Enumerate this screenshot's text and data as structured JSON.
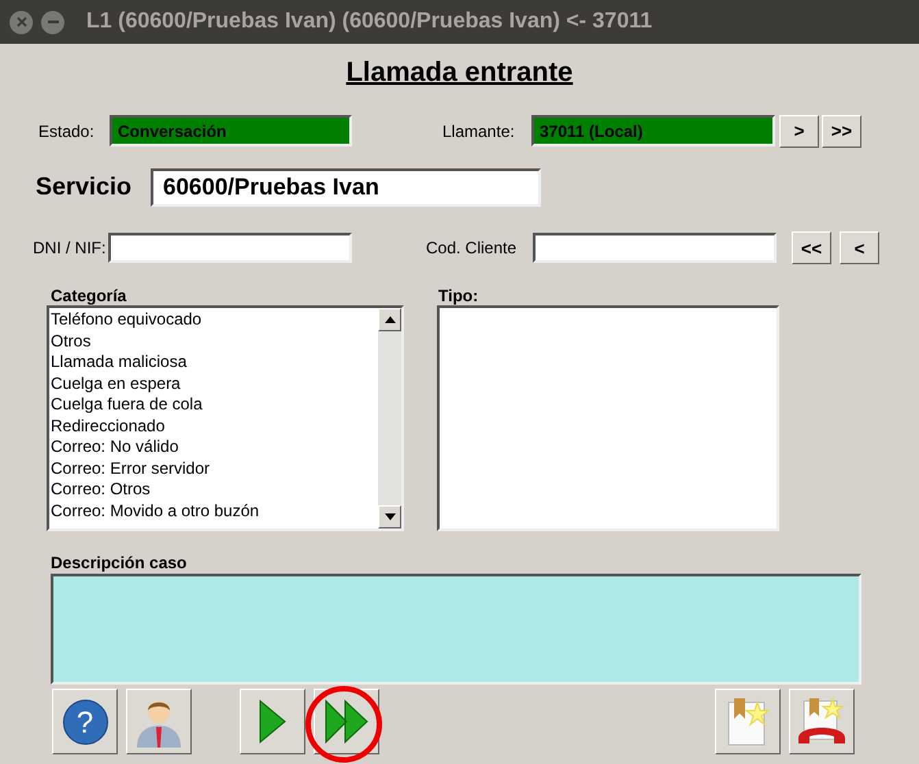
{
  "window": {
    "title": "L1 (60600/Pruebas Ivan) (60600/Pruebas Ivan) <- 37011"
  },
  "heading": "Llamada entrante",
  "estado": {
    "label": "Estado:",
    "value": "Conversación"
  },
  "llamante": {
    "label": "Llamante:",
    "value": "37011 (Local)",
    "buttons": [
      ">",
      ">>"
    ]
  },
  "servicio": {
    "label": "Servicio",
    "value": "60600/Pruebas Ivan"
  },
  "dni": {
    "label": "DNI / NIF:"
  },
  "cod_cliente": {
    "label": "Cod. Cliente",
    "buttons": [
      "<<",
      "<"
    ]
  },
  "categoria": {
    "label": "Categoría",
    "items": [
      "Teléfono equivocado",
      "Otros",
      "Llamada maliciosa",
      "Cuelga en espera",
      "Cuelga fuera de cola",
      "Redireccionado",
      "Correo: No válido",
      "Correo: Error servidor",
      "Correo: Otros",
      "Correo: Movido a otro buzón"
    ]
  },
  "tipo": {
    "label": "Tipo:"
  },
  "descripcion": {
    "label": "Descripción caso"
  },
  "toolbar": [
    {
      "kind": "help",
      "text": "?"
    },
    {
      "kind": "person"
    },
    {
      "kind": "gap"
    },
    {
      "kind": "next"
    },
    {
      "kind": "forward",
      "circled": true
    },
    {
      "kind": "spacer"
    },
    {
      "kind": "bookmark"
    },
    {
      "kind": "bookmark-phone"
    }
  ]
}
